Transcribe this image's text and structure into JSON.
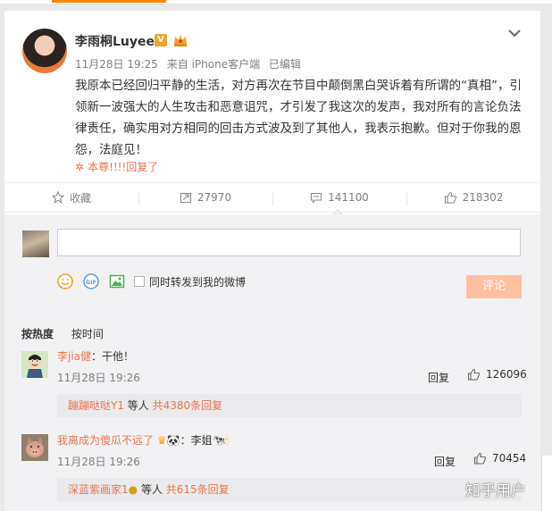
{
  "post": {
    "username": "李雨桐Luyee",
    "verified_badge": "V",
    "time": "11月28日 19:25",
    "source": "来自 iPhone客户端",
    "edited": "已编辑",
    "text": "我原本已经回归平静的生活，对方再次在节目中颠倒黑白哭诉着有所谓的“真相”，引领新一波强大的人生攻击和恶意诅咒，才引发了我这次的发声，我对所有的言论负法律责任，确实用对方相同的回击方式波及到了其他人，我表示抱歉。但对于你我的恩怨，法庭见！",
    "liked_by": "本尊!!!!回复了"
  },
  "actions": {
    "favorite": "收藏",
    "reposts": "27970",
    "comments": "141100",
    "likes": "218302"
  },
  "composer": {
    "placeholder": "",
    "repost_label": "同时转发到我的微博",
    "submit_label": "评论"
  },
  "sort": {
    "hot": "按热度",
    "time": "按时间"
  },
  "comments": [
    {
      "name": "李jia健",
      "text": "：干他！",
      "time": "11月28日 19:26",
      "reply_label": "回复",
      "likes": "126096",
      "sub_user": "蹦蹦哒哒Y1",
      "sub_mid": " 等人 ",
      "sub_count": "共4380条回复"
    },
    {
      "name": "我离成为傻瓜不远了",
      "text": "：李姐",
      "time": "11月28日 19:26",
      "reply_label": "回复",
      "likes": "70454",
      "sub_user": "深蓝紫画家1",
      "sub_mid": " 等人 ",
      "sub_count": "共615条回复"
    }
  ],
  "watermark": "知乎用户",
  "colors": {
    "accent": "#eb7350",
    "tab_orange": "#ff8200",
    "submit_disabled": "#ffc09f"
  }
}
